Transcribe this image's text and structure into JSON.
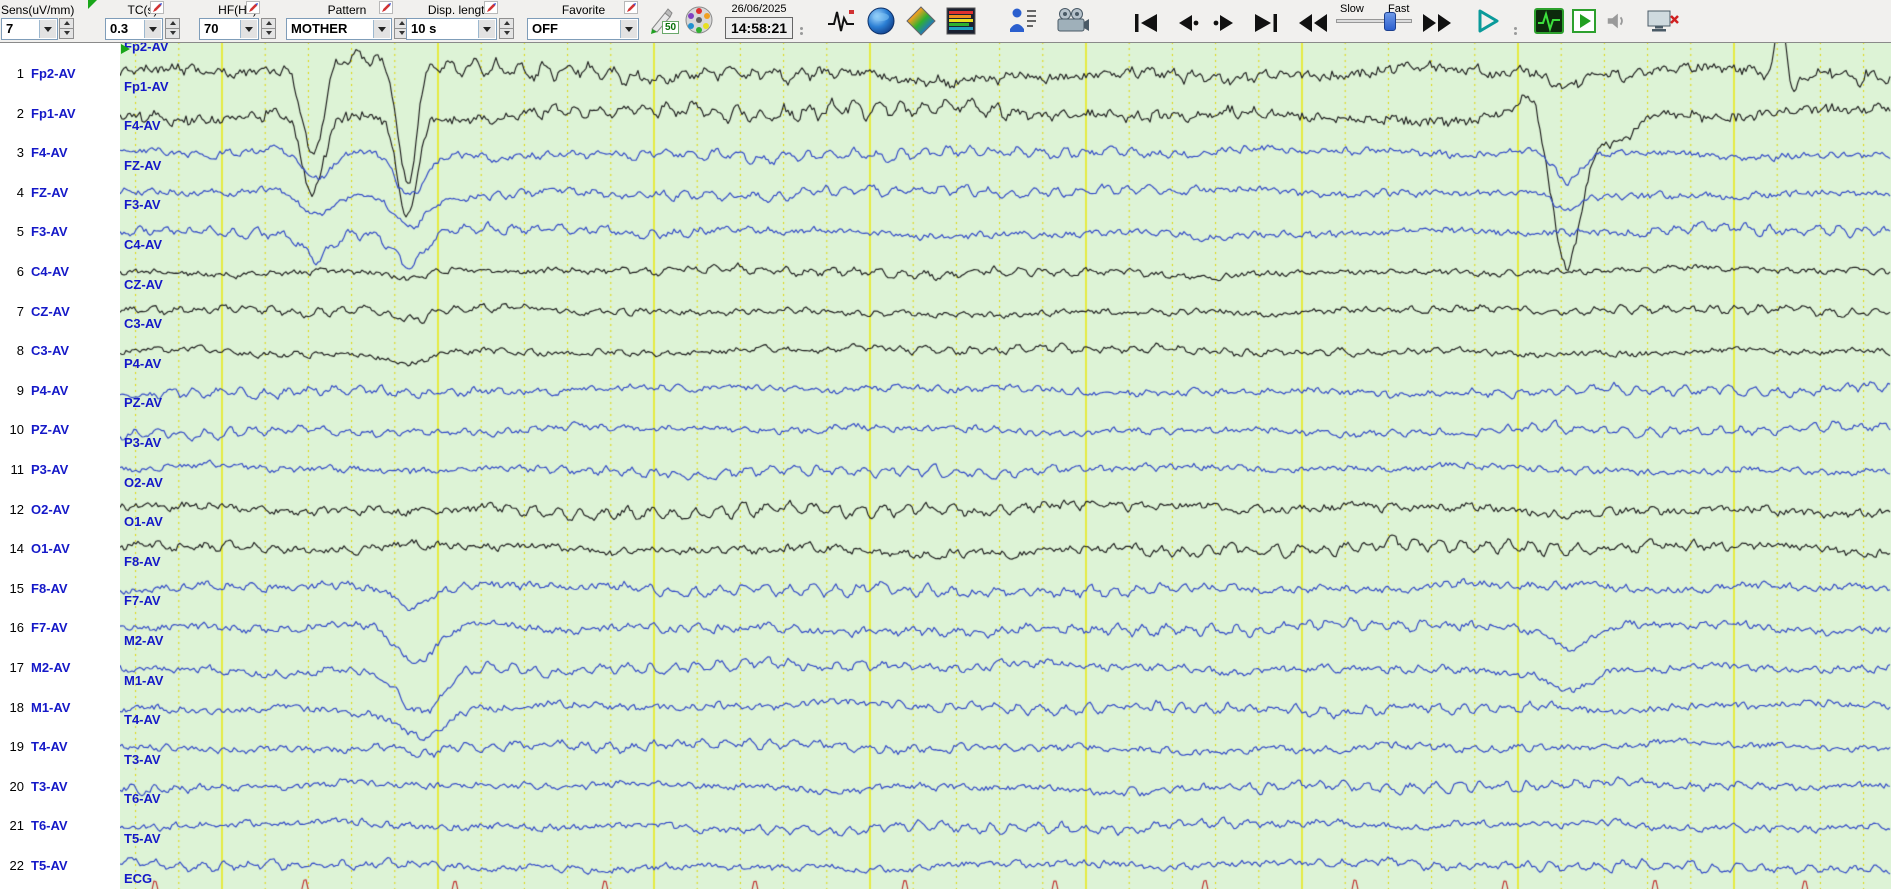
{
  "toolbar": {
    "fields": [
      {
        "label": "Sens(uV/mm)",
        "value": "7"
      },
      {
        "label": "TC(s)",
        "value": "0.3"
      },
      {
        "label": "HF(Hz)",
        "value": "70"
      },
      {
        "label": "Pattern",
        "value": "MOTHER"
      },
      {
        "label": "Disp. length",
        "value": "10 s"
      },
      {
        "label": "Favorite",
        "value": "OFF"
      }
    ],
    "notch_badge": "50",
    "date": "26/06/2025",
    "time": "14:58:21",
    "slow_label": "Slow",
    "fast_label": "Fast"
  },
  "eeg": {
    "channels": [
      {
        "num": "1",
        "label": "Fp2-AV",
        "color": "black"
      },
      {
        "num": "2",
        "label": "Fp1-AV",
        "color": "black"
      },
      {
        "num": "3",
        "label": "F4-AV",
        "color": "blue"
      },
      {
        "num": "4",
        "label": "FZ-AV",
        "color": "blue"
      },
      {
        "num": "5",
        "label": "F3-AV",
        "color": "blue"
      },
      {
        "num": "6",
        "label": "C4-AV",
        "color": "black"
      },
      {
        "num": "7",
        "label": "CZ-AV",
        "color": "black"
      },
      {
        "num": "8",
        "label": "C3-AV",
        "color": "black"
      },
      {
        "num": "9",
        "label": "P4-AV",
        "color": "blue"
      },
      {
        "num": "10",
        "label": "PZ-AV",
        "color": "blue"
      },
      {
        "num": "11",
        "label": "P3-AV",
        "color": "blue"
      },
      {
        "num": "12",
        "label": "O2-AV",
        "color": "black"
      },
      {
        "num": "14",
        "label": "O1-AV",
        "color": "black"
      },
      {
        "num": "15",
        "label": "F8-AV",
        "color": "blue"
      },
      {
        "num": "16",
        "label": "F7-AV",
        "color": "blue"
      },
      {
        "num": "17",
        "label": "M2-AV",
        "color": "blue"
      },
      {
        "num": "18",
        "label": "M1-AV",
        "color": "blue"
      },
      {
        "num": "19",
        "label": "T4-AV",
        "color": "blue"
      },
      {
        "num": "20",
        "label": "T3-AV",
        "color": "blue"
      },
      {
        "num": "21",
        "label": "T6-AV",
        "color": "blue"
      },
      {
        "num": "22",
        "label": "T5-AV",
        "color": "blue"
      },
      {
        "num": "",
        "label": "ECG",
        "color": "red"
      }
    ],
    "colors": {
      "black": "#1e1e1e",
      "blue": "#3048c6",
      "red": "#c03030",
      "bg": "#ddf3d6",
      "grid_solid": "#e9e900",
      "grid_dotted": "#ddd400",
      "label": "#1418c8"
    }
  }
}
